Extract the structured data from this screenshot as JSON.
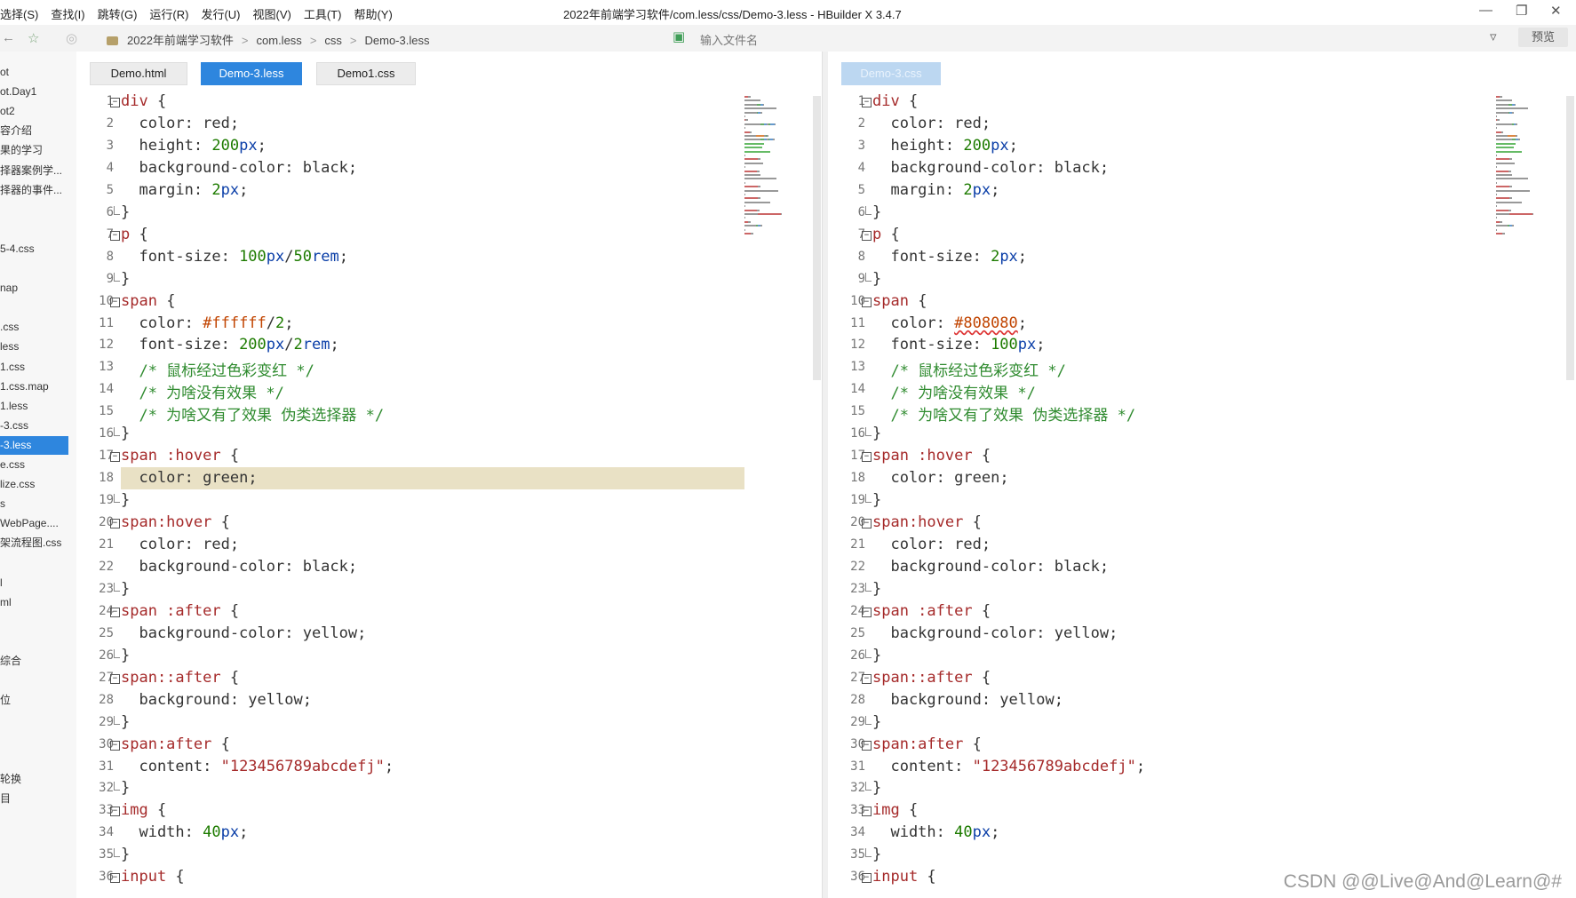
{
  "menubar": {
    "items": [
      "选择(S)",
      "查找(I)",
      "跳转(G)",
      "运行(R)",
      "发行(U)",
      "视图(V)",
      "工具(T)",
      "帮助(Y)"
    ],
    "title": "2022年前端学习软件/com.less/css/Demo-3.less - HBuilder X 3.4.7"
  },
  "pathbar": {
    "crumbs": [
      "2022年前端学习软件",
      "com.less",
      "css",
      "Demo-3.less"
    ],
    "filter_placeholder": "输入文件名",
    "preview_label": "预览"
  },
  "sidebar": {
    "items": [
      {
        "label": "ot",
        "active": false
      },
      {
        "label": "ot.Day1",
        "active": false
      },
      {
        "label": "ot2",
        "active": false
      },
      {
        "label": "容介绍",
        "active": false
      },
      {
        "label": "果的学习",
        "active": false
      },
      {
        "label": "择器案例学...",
        "active": false
      },
      {
        "label": "择器的事件...",
        "active": false
      },
      {
        "label": "",
        "active": false
      },
      {
        "label": "",
        "active": false
      },
      {
        "label": "5-4.css",
        "active": false
      },
      {
        "label": "",
        "active": false
      },
      {
        "label": "nap",
        "active": false
      },
      {
        "label": "",
        "active": false
      },
      {
        "label": ".css",
        "active": false
      },
      {
        "label": "less",
        "active": false
      },
      {
        "label": "1.css",
        "active": false
      },
      {
        "label": "1.css.map",
        "active": false
      },
      {
        "label": "1.less",
        "active": false
      },
      {
        "label": "-3.css",
        "active": false
      },
      {
        "label": "-3.less",
        "active": true
      },
      {
        "label": "e.css",
        "active": false
      },
      {
        "label": "lize.css",
        "active": false
      },
      {
        "label": "s",
        "active": false
      },
      {
        "label": "WebPage....",
        "active": false
      },
      {
        "label": "架流程图.css",
        "active": false
      },
      {
        "label": "",
        "active": false
      },
      {
        "label": "l",
        "active": false
      },
      {
        "label": "ml",
        "active": false
      },
      {
        "label": "",
        "active": false
      },
      {
        "label": "",
        "active": false
      },
      {
        "label": "综合",
        "active": false
      },
      {
        "label": "",
        "active": false
      },
      {
        "label": "位",
        "active": false
      },
      {
        "label": "",
        "active": false
      },
      {
        "label": "",
        "active": false
      },
      {
        "label": "",
        "active": false
      },
      {
        "label": "轮换",
        "active": false
      },
      {
        "label": "目",
        "active": false
      }
    ]
  },
  "left_editor": {
    "tabs": [
      {
        "label": "Demo.html",
        "state": "normal"
      },
      {
        "label": "Demo-3.less",
        "state": "active"
      },
      {
        "label": "Demo1.css",
        "state": "normal"
      }
    ],
    "highlight_line": 18,
    "lines": [
      [
        [
          "sel",
          "div"
        ],
        [
          "punct",
          " {"
        ]
      ],
      [
        [
          "prop",
          "  color: "
        ],
        [
          "prop",
          "red"
        ],
        [
          "punct",
          ";"
        ]
      ],
      [
        [
          "prop",
          "  height: "
        ],
        [
          "num",
          "200"
        ],
        [
          "unit",
          "px"
        ],
        [
          "punct",
          ";"
        ]
      ],
      [
        [
          "prop",
          "  background-color: "
        ],
        [
          "prop",
          "black"
        ],
        [
          "punct",
          ";"
        ]
      ],
      [
        [
          "prop",
          "  margin: "
        ],
        [
          "num",
          "2"
        ],
        [
          "unit",
          "px"
        ],
        [
          "punct",
          ";"
        ]
      ],
      [
        [
          "punct",
          "}"
        ]
      ],
      [
        [
          "sel",
          "p"
        ],
        [
          "punct",
          " {"
        ]
      ],
      [
        [
          "prop",
          "  font-size: "
        ],
        [
          "num",
          "100"
        ],
        [
          "unit",
          "px"
        ],
        [
          "punct",
          "/"
        ],
        [
          "num",
          "50"
        ],
        [
          "unit",
          "rem"
        ],
        [
          "punct",
          ";"
        ]
      ],
      [
        [
          "punct",
          "}"
        ]
      ],
      [
        [
          "sel",
          "span"
        ],
        [
          "punct",
          " {"
        ]
      ],
      [
        [
          "prop",
          "  color: "
        ],
        [
          "hex",
          "#ffffff"
        ],
        [
          "punct",
          "/"
        ],
        [
          "num",
          "2"
        ],
        [
          "punct",
          ";"
        ]
      ],
      [
        [
          "prop",
          "  font-size: "
        ],
        [
          "num",
          "200"
        ],
        [
          "unit",
          "px"
        ],
        [
          "punct",
          "/"
        ],
        [
          "num",
          "2"
        ],
        [
          "unit",
          "rem"
        ],
        [
          "punct",
          ";"
        ]
      ],
      [
        [
          "com",
          "  /* 鼠标经过色彩变红 */"
        ]
      ],
      [
        [
          "com",
          "  /* 为啥没有效果 */"
        ]
      ],
      [
        [
          "com",
          "  /* 为啥又有了效果 伪类选择器 */"
        ]
      ],
      [
        [
          "punct",
          "}"
        ]
      ],
      [
        [
          "sel",
          "span :hover"
        ],
        [
          "punct",
          " {"
        ]
      ],
      [
        [
          "prop",
          "  color: "
        ],
        [
          "prop",
          "green"
        ],
        [
          "punct",
          ";"
        ]
      ],
      [
        [
          "punct",
          "}"
        ]
      ],
      [
        [
          "sel",
          "span:hover"
        ],
        [
          "punct",
          " {"
        ]
      ],
      [
        [
          "prop",
          "  color: "
        ],
        [
          "prop",
          "red"
        ],
        [
          "punct",
          ";"
        ]
      ],
      [
        [
          "prop",
          "  background-color: "
        ],
        [
          "prop",
          "black"
        ],
        [
          "punct",
          ";"
        ]
      ],
      [
        [
          "punct",
          "}"
        ]
      ],
      [
        [
          "sel",
          "span :after"
        ],
        [
          "punct",
          " {"
        ]
      ],
      [
        [
          "prop",
          "  background-color: "
        ],
        [
          "prop",
          "yellow"
        ],
        [
          "punct",
          ";"
        ]
      ],
      [
        [
          "punct",
          "}"
        ]
      ],
      [
        [
          "sel",
          "span::after"
        ],
        [
          "punct",
          " {"
        ]
      ],
      [
        [
          "prop",
          "  background: "
        ],
        [
          "prop",
          "yellow"
        ],
        [
          "punct",
          ";"
        ]
      ],
      [
        [
          "punct",
          "}"
        ]
      ],
      [
        [
          "sel",
          "span:after"
        ],
        [
          "punct",
          " {"
        ]
      ],
      [
        [
          "prop",
          "  content: "
        ],
        [
          "str",
          "\"123456789abcdefj\""
        ],
        [
          "punct",
          ";"
        ]
      ],
      [
        [
          "punct",
          "}"
        ]
      ],
      [
        [
          "sel",
          "img"
        ],
        [
          "punct",
          " {"
        ]
      ],
      [
        [
          "prop",
          "  width: "
        ],
        [
          "num",
          "40"
        ],
        [
          "unit",
          "px"
        ],
        [
          "punct",
          ";"
        ]
      ],
      [
        [
          "punct",
          "}"
        ]
      ],
      [
        [
          "sel",
          "input"
        ],
        [
          "punct",
          " {"
        ]
      ]
    ]
  },
  "right_editor": {
    "tabs": [
      {
        "label": "Demo-3.css",
        "state": "faded"
      }
    ],
    "highlight_line": 0,
    "lines": [
      [
        [
          "sel",
          "div"
        ],
        [
          "punct",
          " {"
        ]
      ],
      [
        [
          "prop",
          "  color: "
        ],
        [
          "prop",
          "red"
        ],
        [
          "punct",
          ";"
        ]
      ],
      [
        [
          "prop",
          "  height: "
        ],
        [
          "num",
          "200"
        ],
        [
          "unit",
          "px"
        ],
        [
          "punct",
          ";"
        ]
      ],
      [
        [
          "prop",
          "  background-color: "
        ],
        [
          "prop",
          "black"
        ],
        [
          "punct",
          ";"
        ]
      ],
      [
        [
          "prop",
          "  margin: "
        ],
        [
          "num",
          "2"
        ],
        [
          "unit",
          "px"
        ],
        [
          "punct",
          ";"
        ]
      ],
      [
        [
          "punct",
          "}"
        ]
      ],
      [
        [
          "sel",
          "p"
        ],
        [
          "punct",
          " {"
        ]
      ],
      [
        [
          "prop",
          "  font-size: "
        ],
        [
          "num",
          "2"
        ],
        [
          "unit",
          "px"
        ],
        [
          "punct",
          ";"
        ]
      ],
      [
        [
          "punct",
          "}"
        ]
      ],
      [
        [
          "sel",
          "span"
        ],
        [
          "punct",
          " {"
        ]
      ],
      [
        [
          "prop",
          "  color: "
        ],
        [
          "hexerr",
          "#808080"
        ],
        [
          "punct",
          ";"
        ]
      ],
      [
        [
          "prop",
          "  font-size: "
        ],
        [
          "num",
          "100"
        ],
        [
          "unit",
          "px"
        ],
        [
          "punct",
          ";"
        ]
      ],
      [
        [
          "com",
          "  /* 鼠标经过色彩变红 */"
        ]
      ],
      [
        [
          "com",
          "  /* 为啥没有效果 */"
        ]
      ],
      [
        [
          "com",
          "  /* 为啥又有了效果 伪类选择器 */"
        ]
      ],
      [
        [
          "punct",
          "}"
        ]
      ],
      [
        [
          "sel",
          "span :hover"
        ],
        [
          "punct",
          " {"
        ]
      ],
      [
        [
          "prop",
          "  color: "
        ],
        [
          "prop",
          "green"
        ],
        [
          "punct",
          ";"
        ]
      ],
      [
        [
          "punct",
          "}"
        ]
      ],
      [
        [
          "sel",
          "span:hover"
        ],
        [
          "punct",
          " {"
        ]
      ],
      [
        [
          "prop",
          "  color: "
        ],
        [
          "prop",
          "red"
        ],
        [
          "punct",
          ";"
        ]
      ],
      [
        [
          "prop",
          "  background-color: "
        ],
        [
          "prop",
          "black"
        ],
        [
          "punct",
          ";"
        ]
      ],
      [
        [
          "punct",
          "}"
        ]
      ],
      [
        [
          "sel",
          "span :after"
        ],
        [
          "punct",
          " {"
        ]
      ],
      [
        [
          "prop",
          "  background-color: "
        ],
        [
          "prop",
          "yellow"
        ],
        [
          "punct",
          ";"
        ]
      ],
      [
        [
          "punct",
          "}"
        ]
      ],
      [
        [
          "sel",
          "span::after"
        ],
        [
          "punct",
          " {"
        ]
      ],
      [
        [
          "prop",
          "  background: "
        ],
        [
          "prop",
          "yellow"
        ],
        [
          "punct",
          ";"
        ]
      ],
      [
        [
          "punct",
          "}"
        ]
      ],
      [
        [
          "sel",
          "span:after"
        ],
        [
          "punct",
          " {"
        ]
      ],
      [
        [
          "prop",
          "  content: "
        ],
        [
          "str",
          "\"123456789abcdefj\""
        ],
        [
          "punct",
          ";"
        ]
      ],
      [
        [
          "punct",
          "}"
        ]
      ],
      [
        [
          "sel",
          "img"
        ],
        [
          "punct",
          " {"
        ]
      ],
      [
        [
          "prop",
          "  width: "
        ],
        [
          "num",
          "40"
        ],
        [
          "unit",
          "px"
        ],
        [
          "punct",
          ";"
        ]
      ],
      [
        [
          "punct",
          "}"
        ]
      ],
      [
        [
          "sel",
          "input"
        ],
        [
          "punct",
          " {"
        ]
      ]
    ]
  },
  "watermark": "CSDN @@Live@And@Learn@#",
  "colors": {
    "accent": "#2e86de",
    "selector": "#a52a2a",
    "number": "#1d7b00",
    "unit": "#0b3fa8",
    "comment": "#2f8b2f",
    "hex": "#c14400",
    "line_highlight": "#e9e1c5"
  },
  "icons": [
    "star-icon",
    "folder-icon",
    "file-search-icon",
    "filter-icon",
    "minimize-icon",
    "restore-icon",
    "close-icon"
  ]
}
